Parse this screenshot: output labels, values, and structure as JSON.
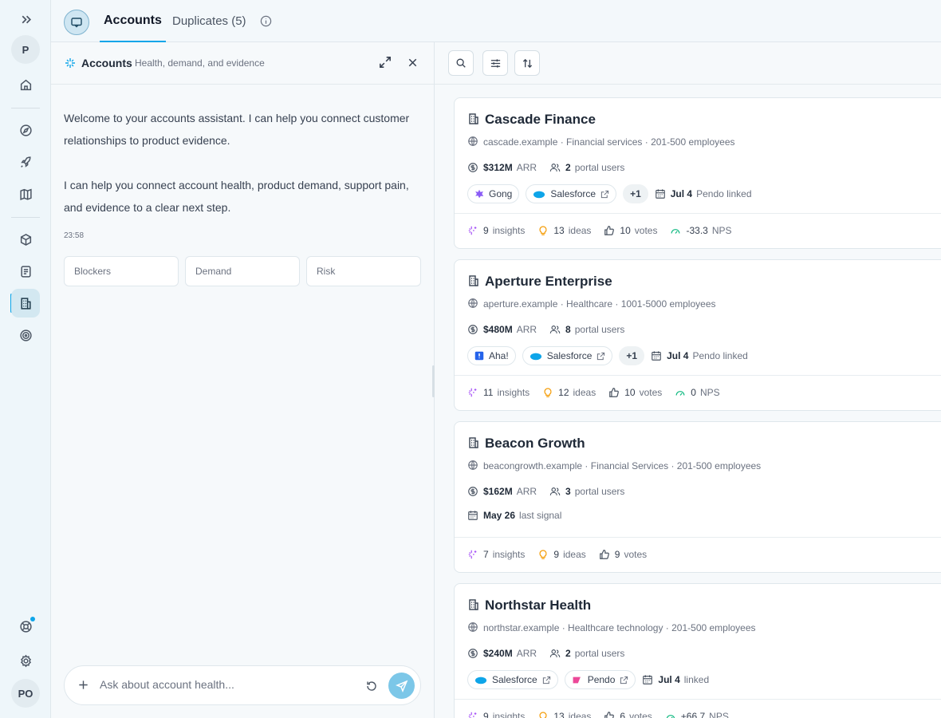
{
  "rail": {
    "workspace_initial": "P",
    "user_initials": "PO"
  },
  "tabs": [
    {
      "label": "Accounts"
    },
    {
      "label": "Duplicates (5)"
    }
  ],
  "assistant": {
    "title": "Accounts",
    "subtitle": "Health, demand, and evidence",
    "message_1": "Welcome to your accounts assistant. I can help you connect customer relationships to product evidence.",
    "message_2": "I can help you connect account health, product demand, support pain, and evidence to a clear next step.",
    "timestamp": "23:58",
    "chips": [
      "Blockers",
      "Demand",
      "Risk"
    ],
    "composer_placeholder": "Ask about account health..."
  },
  "accounts": [
    {
      "name": "Cascade Finance",
      "meta": "cascade.example · Financial services · 201-500 employees",
      "arr": "$312M",
      "arr_label": "ARR",
      "portal_users": "2",
      "portal_label": "portal users",
      "integrations": [
        "Gong",
        "Salesforce"
      ],
      "more": "+1",
      "date": "Jul 4",
      "date_label": "Pendo linked",
      "insights": "9",
      "ideas": "13",
      "votes": "10",
      "nps": "-33.3"
    },
    {
      "name": "Aperture Enterprise",
      "meta": "aperture.example · Healthcare · 1001-5000 employees",
      "arr": "$480M",
      "arr_label": "ARR",
      "portal_users": "8",
      "portal_label": "portal users",
      "integrations": [
        "Aha!",
        "Salesforce"
      ],
      "more": "+1",
      "date": "Jul 4",
      "date_label": "Pendo linked",
      "insights": "11",
      "ideas": "12",
      "votes": "10",
      "nps": "0"
    },
    {
      "name": "Beacon Growth",
      "meta": "beacongrowth.example · Financial Services · 201-500 employees",
      "arr": "$162M",
      "arr_label": "ARR",
      "portal_users": "3",
      "portal_label": "portal users",
      "date": "May 26",
      "date_label": "last signal",
      "insights": "7",
      "ideas": "9",
      "votes": "9"
    },
    {
      "name": "Northstar Health",
      "meta": "northstar.example · Healthcare technology · 201-500 employees",
      "arr": "$240M",
      "arr_label": "ARR",
      "portal_users": "2",
      "portal_label": "portal users",
      "integrations": [
        "Salesforce",
        "Pendo"
      ],
      "date": "Jul 4",
      "date_label": "linked",
      "insights": "9",
      "ideas": "13",
      "votes": "6",
      "nps": "+66.7"
    }
  ],
  "labels": {
    "insights": "insights",
    "ideas": "ideas",
    "votes": "votes",
    "nps": "NPS"
  }
}
